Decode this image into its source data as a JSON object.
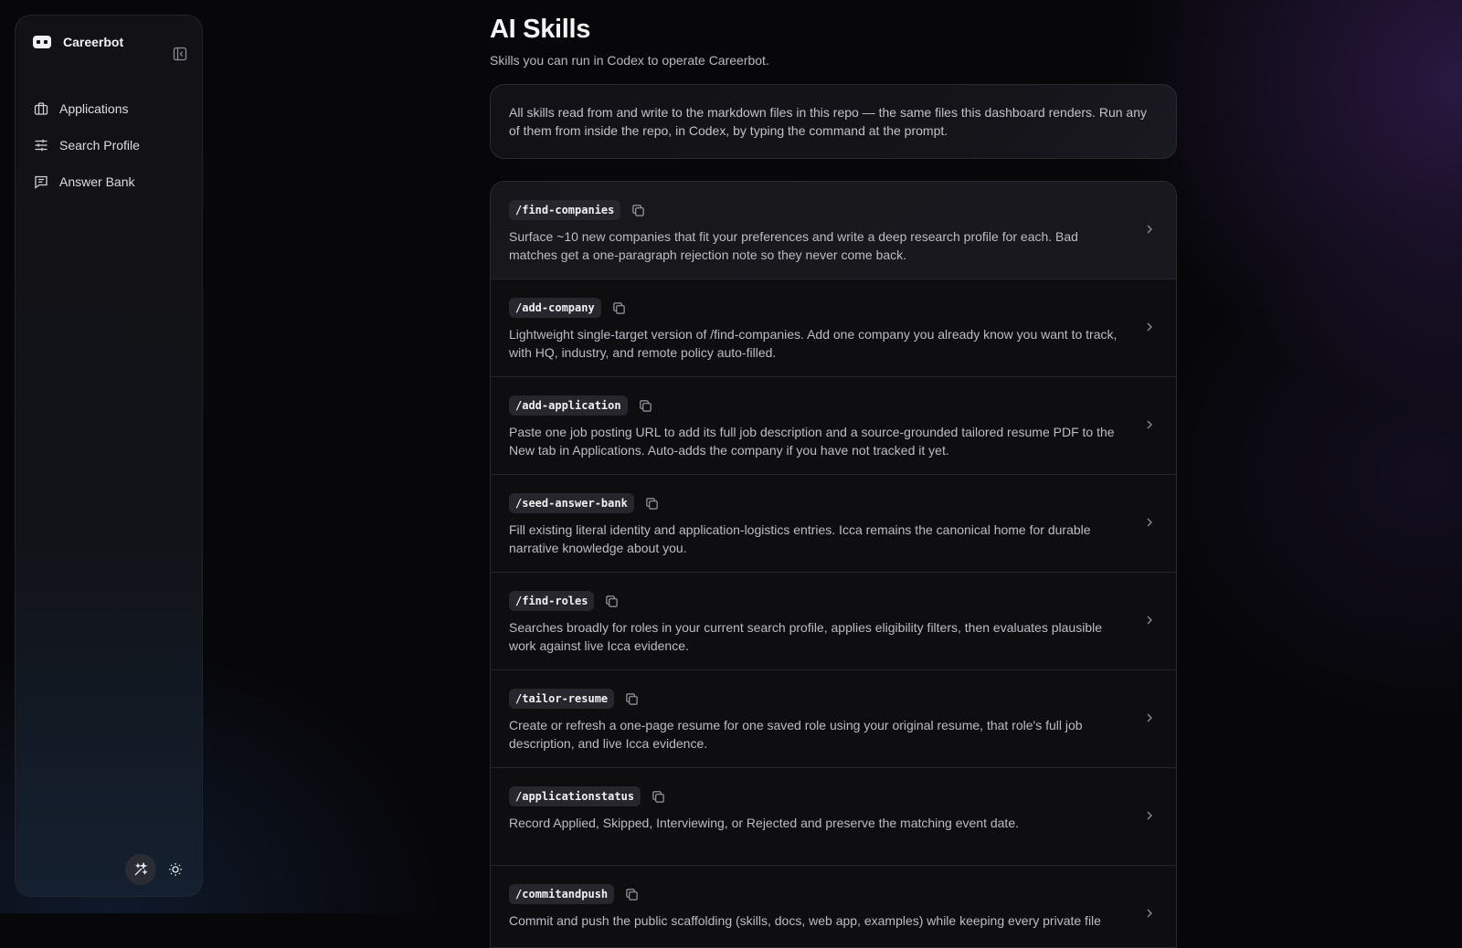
{
  "app": {
    "name": "Careerbot"
  },
  "sidebar": {
    "items": [
      {
        "label": "Applications",
        "icon": "briefcase-icon"
      },
      {
        "label": "Search Profile",
        "icon": "sliders-icon"
      },
      {
        "label": "Answer Bank",
        "icon": "message-square-icon"
      }
    ]
  },
  "main": {
    "title": "AI Skills",
    "subtitle": "Skills you can run in Codex to operate Careerbot.",
    "info": "All skills read from and write to the markdown files in this repo — the same files this dashboard renders. Run any of them from inside the repo, in Codex, by typing the command at the prompt.",
    "skills": [
      {
        "command": "/find-companies",
        "description": "Surface ~10 new companies that fit your preferences and write a deep research profile for each. Bad matches get a one-paragraph rejection note so they never come back."
      },
      {
        "command": "/add-company",
        "description": "Lightweight single-target version of /find-companies. Add one company you already know you want to track, with HQ, industry, and remote policy auto-filled."
      },
      {
        "command": "/add-application",
        "description": "Paste one job posting URL to add its full job description and a source-grounded tailored resume PDF to the New tab in Applications. Auto-adds the company if you have not tracked it yet."
      },
      {
        "command": "/seed-answer-bank",
        "description": "Fill existing literal identity and application-logistics entries. Icca remains the canonical home for durable narrative knowledge about you."
      },
      {
        "command": "/find-roles",
        "description": "Searches broadly for roles in your current search profile, applies eligibility filters, then evaluates plausible work against live Icca evidence."
      },
      {
        "command": "/tailor-resume",
        "description": "Create or refresh a one-page resume for one saved role using your original resume, that role's full job description, and live Icca evidence."
      },
      {
        "command": "/applicationstatus",
        "description": "Record Applied, Skipped, Interviewing, or Rejected and preserve the matching event date."
      },
      {
        "command": "/commitandpush",
        "description": "Commit and push the public scaffolding (skills, docs, web app, examples) while keeping every private file"
      }
    ]
  },
  "colors": {
    "accent_bg": "#07070a",
    "purple_glow": "#46266e",
    "blue_glow": "#16284a"
  }
}
